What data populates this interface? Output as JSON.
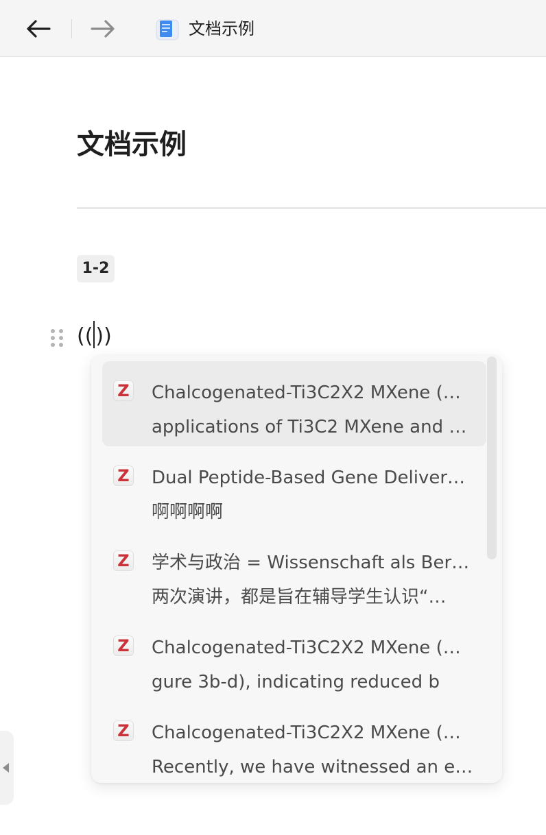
{
  "topbar": {
    "back_icon": "arrow-left-icon",
    "forward_icon": "arrow-right-icon",
    "doc_icon": "document-icon",
    "tab_title": "文档示例"
  },
  "document": {
    "title": "文档示例",
    "page_range": "1-2",
    "editor_text_before": "((",
    "editor_text_after": "))"
  },
  "popup": {
    "item_icon": "zotero-icon",
    "item_icon_letter": "Z",
    "items": [
      {
        "line1": "Chalcogenated-Ti3C2X2 MXene (…",
        "line2": "applications of Ti3C2 MXene and …",
        "selected": true
      },
      {
        "line1": "Dual Peptide-Based Gene Deliver…",
        "line2": "啊啊啊啊",
        "selected": false
      },
      {
        "line1": "学术与政治 = Wissenschaft als Ber…",
        "line2": "两次演讲，都是旨在辅导学生认识“…",
        "selected": false
      },
      {
        "line1": "Chalcogenated-Ti3C2X2 MXene (…",
        "line2": "gure 3b-d), indicating reduced b",
        "selected": false
      },
      {
        "line1": "Chalcogenated-Ti3C2X2 MXene (…",
        "line2": "Recently, we have witnessed an e…",
        "selected": false
      }
    ]
  },
  "colors": {
    "accent_z": "#c9343a",
    "topbar_bg": "#f5f5f5",
    "popup_bg": "#f7f7f7",
    "selected_bg": "#ebebeb"
  }
}
